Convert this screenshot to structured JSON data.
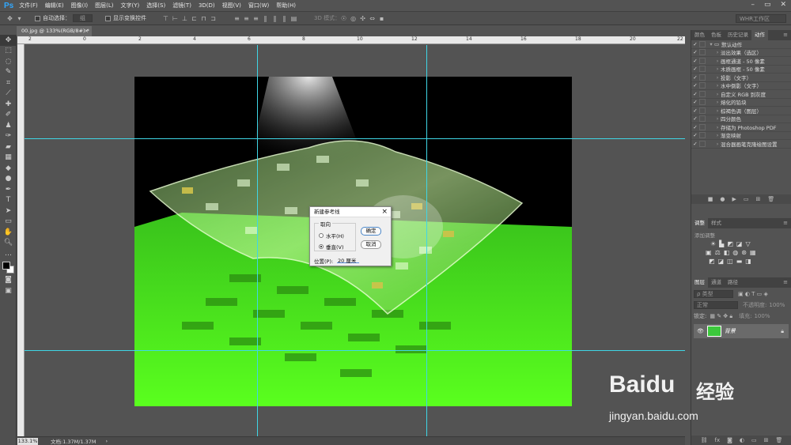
{
  "menubar": {
    "logo": "Ps",
    "items": [
      "文件(F)",
      "编辑(E)",
      "图像(I)",
      "图层(L)",
      "文字(Y)",
      "选择(S)",
      "滤镜(T)",
      "3D(D)",
      "视图(V)",
      "窗口(W)",
      "帮助(H)"
    ]
  },
  "options": {
    "auto_select": "自动选择：",
    "auto_select_value": "组",
    "show_transform": "显示变换控件",
    "mode_3d": "3D 模式：",
    "workspace": "WHR工作区"
  },
  "document": {
    "tab_title": "00.jpg @ 133%(RGB/8#) *",
    "zoom": "133.1%",
    "doc_info": "文档:1.37M/1.37M"
  },
  "ruler": {
    "top_numbers": [
      "2",
      "0",
      "2",
      "4",
      "6",
      "8",
      "10",
      "12",
      "14",
      "16",
      "18",
      "20",
      "22"
    ]
  },
  "dialog": {
    "title": "新建参考线",
    "orientation_label": "取向",
    "horizontal": "水平(H)",
    "vertical": "垂直(V)",
    "ok": "确定",
    "cancel": "取消",
    "position_label": "位置(P):",
    "position_value": "20 厘米",
    "selected": "vertical"
  },
  "panel_top": {
    "tabs": [
      "颜色",
      "色板",
      "历史记录",
      "动作"
    ],
    "active_tab": "动作",
    "actions": [
      {
        "label": "默认动作",
        "folder": true
      },
      {
        "label": "淡出效果（选区）"
      },
      {
        "label": "画框通道 - 50 像素"
      },
      {
        "label": "木质画框 - 50 像素"
      },
      {
        "label": "投影（文字）"
      },
      {
        "label": "水中倒影（文字）"
      },
      {
        "label": "自定义 RGB 到灰度"
      },
      {
        "label": "熔化的铅块"
      },
      {
        "label": "棕褐色调（图层）"
      },
      {
        "label": "四分颜色"
      },
      {
        "label": "存储为 Photoshop PDF"
      },
      {
        "label": "渐变映射"
      },
      {
        "label": "混合器画笔克隆绘图设置"
      }
    ]
  },
  "panel_mid": {
    "tabs": [
      "调整",
      "样式"
    ],
    "active_tab": "调整",
    "add_label": "添加调整"
  },
  "panel_layers": {
    "tabs": [
      "图层",
      "通道",
      "路径"
    ],
    "active_tab": "图层",
    "filter": "ρ 类型",
    "blend": "正常",
    "opacity_label": "不透明度:",
    "opacity": "100%",
    "lock_label": "锁定:",
    "fill_label": "填充:",
    "fill": "100%",
    "layer_name": "背景"
  },
  "watermark": {
    "brand": "Baidu",
    "cn": "经验",
    "url": "jingyan.baidu.com"
  },
  "colors": {
    "guide": "#3fd6e6",
    "accent": "#31a8ff",
    "fg": "#000000",
    "bg": "#ffffff"
  }
}
